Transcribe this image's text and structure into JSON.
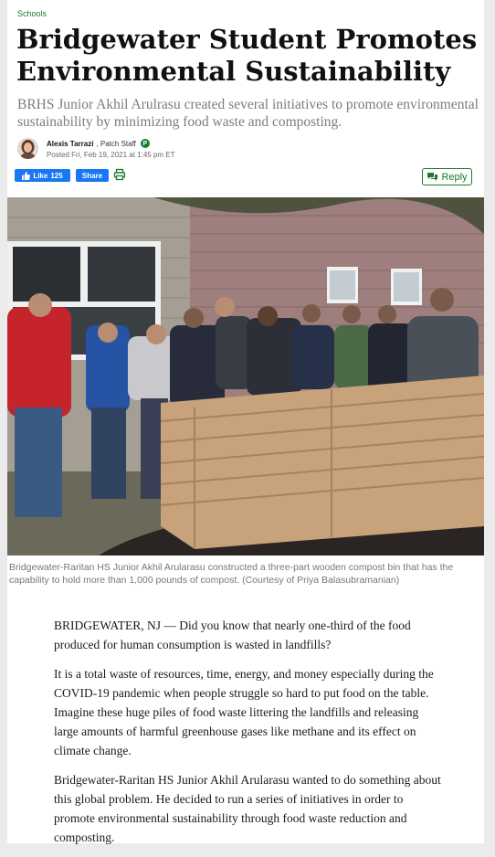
{
  "article": {
    "category": "Schools",
    "headline": "Bridgewater Student Promotes Environmental Sustainability",
    "dek": "BRHS Junior Akhil Arulrasu created several initiatives to promote environmental sustainability by minimizing food waste and composting.",
    "author": {
      "name": "Alexis Tarrazi",
      "role": ", Patch Staff",
      "badge": "P",
      "posted": "Posted Fri, Feb 19, 2021 at 1:45 pm ET"
    },
    "actions": {
      "like_label": "Like",
      "like_count": "125",
      "share_label": "Share",
      "print_icon": "print-icon",
      "reply_label": "Reply",
      "reply_icon": "speech-bubbles-icon"
    },
    "image": {
      "caption": "Bridgewater-Raritan HS Junior Akhil Arularasu constructed a three-part wooden compost bin that has the capability to hold more than 1,000 pounds of compost. (Courtesy of Priya Balasubramanian)"
    },
    "body": [
      "BRIDGEWATER, NJ — Did you know that nearly one-third of the food produced for human consumption is wasted in landfills?",
      "It is a total waste of resources, time, energy, and money especially during the COVID-19 pandemic when people struggle so hard to put food on the table. Imagine these huge piles of food waste littering the landfills and releasing large amounts of harmful greenhouse gases like methane and its effect on climate change.",
      "Bridgewater-Raritan HS Junior Akhil Arularasu wanted to do something about this global problem. He decided to run a series of initiatives in order to promote environmental sustainability through food waste reduction and composting."
    ]
  },
  "colors": {
    "patch_green": "#1b7a2e",
    "facebook_blue": "#1877f2",
    "headline": "#111111",
    "dek": "#7c7c7c"
  }
}
